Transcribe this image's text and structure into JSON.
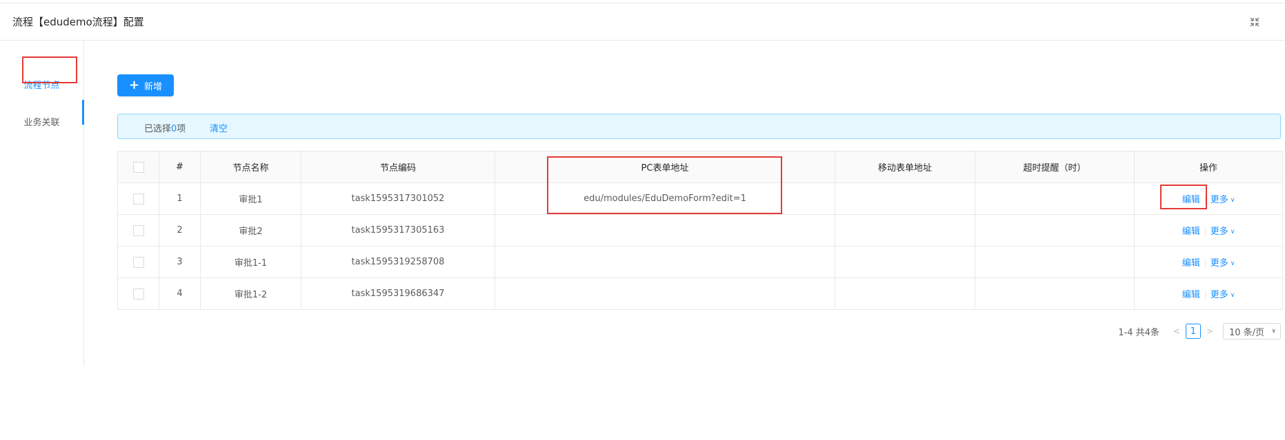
{
  "modal": {
    "title": "流程【edudemo流程】配置",
    "collapse_icon": "shrink-icon"
  },
  "sidebar": {
    "items": [
      {
        "label": "流程节点",
        "active": true
      },
      {
        "label": "业务关联",
        "active": false
      }
    ]
  },
  "toolbar": {
    "add_label": "新增",
    "add_icon": "plus-icon"
  },
  "selection": {
    "prefix": "已选择",
    "count": "0",
    "suffix": "项",
    "clear_label": "清空"
  },
  "table": {
    "columns": [
      "#",
      "节点名称",
      "节点编码",
      "PC表单地址",
      "移动表单地址",
      "超时提醒（时）",
      "操作"
    ],
    "rows": [
      {
        "index": "1",
        "name": "审批1",
        "code": "task1595317301052",
        "pc_form": "edu/modules/EduDemoForm?edit=1",
        "mobile_form": "",
        "timeout": ""
      },
      {
        "index": "2",
        "name": "审批2",
        "code": "task1595317305163",
        "pc_form": "",
        "mobile_form": "",
        "timeout": ""
      },
      {
        "index": "3",
        "name": "审批1-1",
        "code": "task1595319258708",
        "pc_form": "",
        "mobile_form": "",
        "timeout": ""
      },
      {
        "index": "4",
        "name": "审批1-2",
        "code": "task1595319686347",
        "pc_form": "",
        "mobile_form": "",
        "timeout": ""
      }
    ],
    "actions": {
      "edit": "编辑",
      "more": "更多"
    }
  },
  "pagination": {
    "total_text": "1-4 共4条",
    "current_page": "1",
    "page_size": "10 条/页",
    "prev_icon": "chevron-left-icon",
    "next_icon": "chevron-right-icon"
  },
  "colors": {
    "primary": "#1890ff",
    "highlight_box": "#e53935",
    "alert_bg": "#e6f7ff"
  }
}
